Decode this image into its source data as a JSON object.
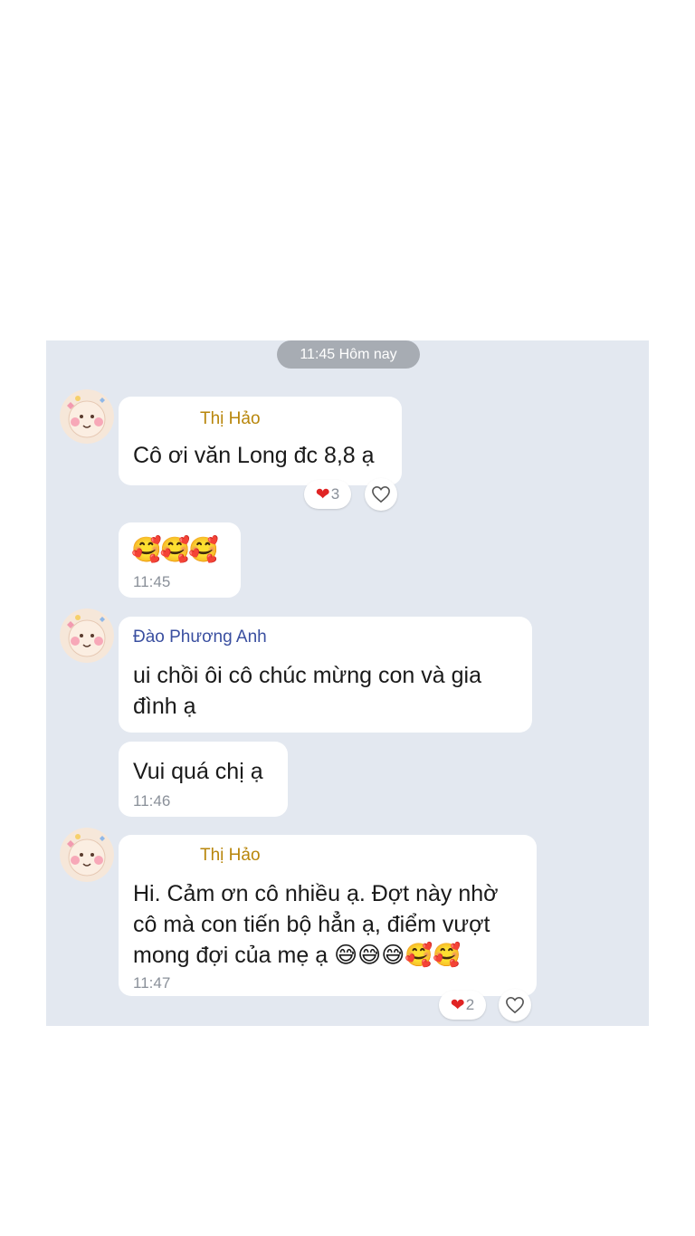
{
  "date_divider": "11:45 Hôm nay",
  "messages": [
    {
      "sender": "Thị Hảo",
      "text": "Cô ơi văn Long đc 8,8 ạ",
      "reaction_count": "3"
    },
    {
      "emojis": "🥰🥰🥰",
      "time": "11:45"
    },
    {
      "sender": "Đào Phương Anh",
      "line1": "ui chồi ôi cô chúc mừng con và gia",
      "line2": "đình ạ"
    },
    {
      "text": "Vui quá chị ạ",
      "time": "11:46"
    },
    {
      "sender": "Thị Hảo",
      "line1": "Hi. Cảm ơn cô nhiều ạ. Đợt này nhờ",
      "line2": "cô mà con tiến bộ hẳn ạ, điểm vượt",
      "line3": "mong đợi của mẹ ạ",
      "emojis": "😅😅😅🥰🥰",
      "time": "11:47",
      "reaction_count": "2"
    }
  ],
  "icons": {
    "reaction": "heart-icon",
    "like": "heart-outline-icon",
    "avatar": "baby-avatar-icon"
  },
  "colors": {
    "panel_bg": "#e3e8f0",
    "gold_sender": "#b8860b",
    "blue_sender": "#3a4fa0",
    "reaction_heart": "#e02424"
  }
}
